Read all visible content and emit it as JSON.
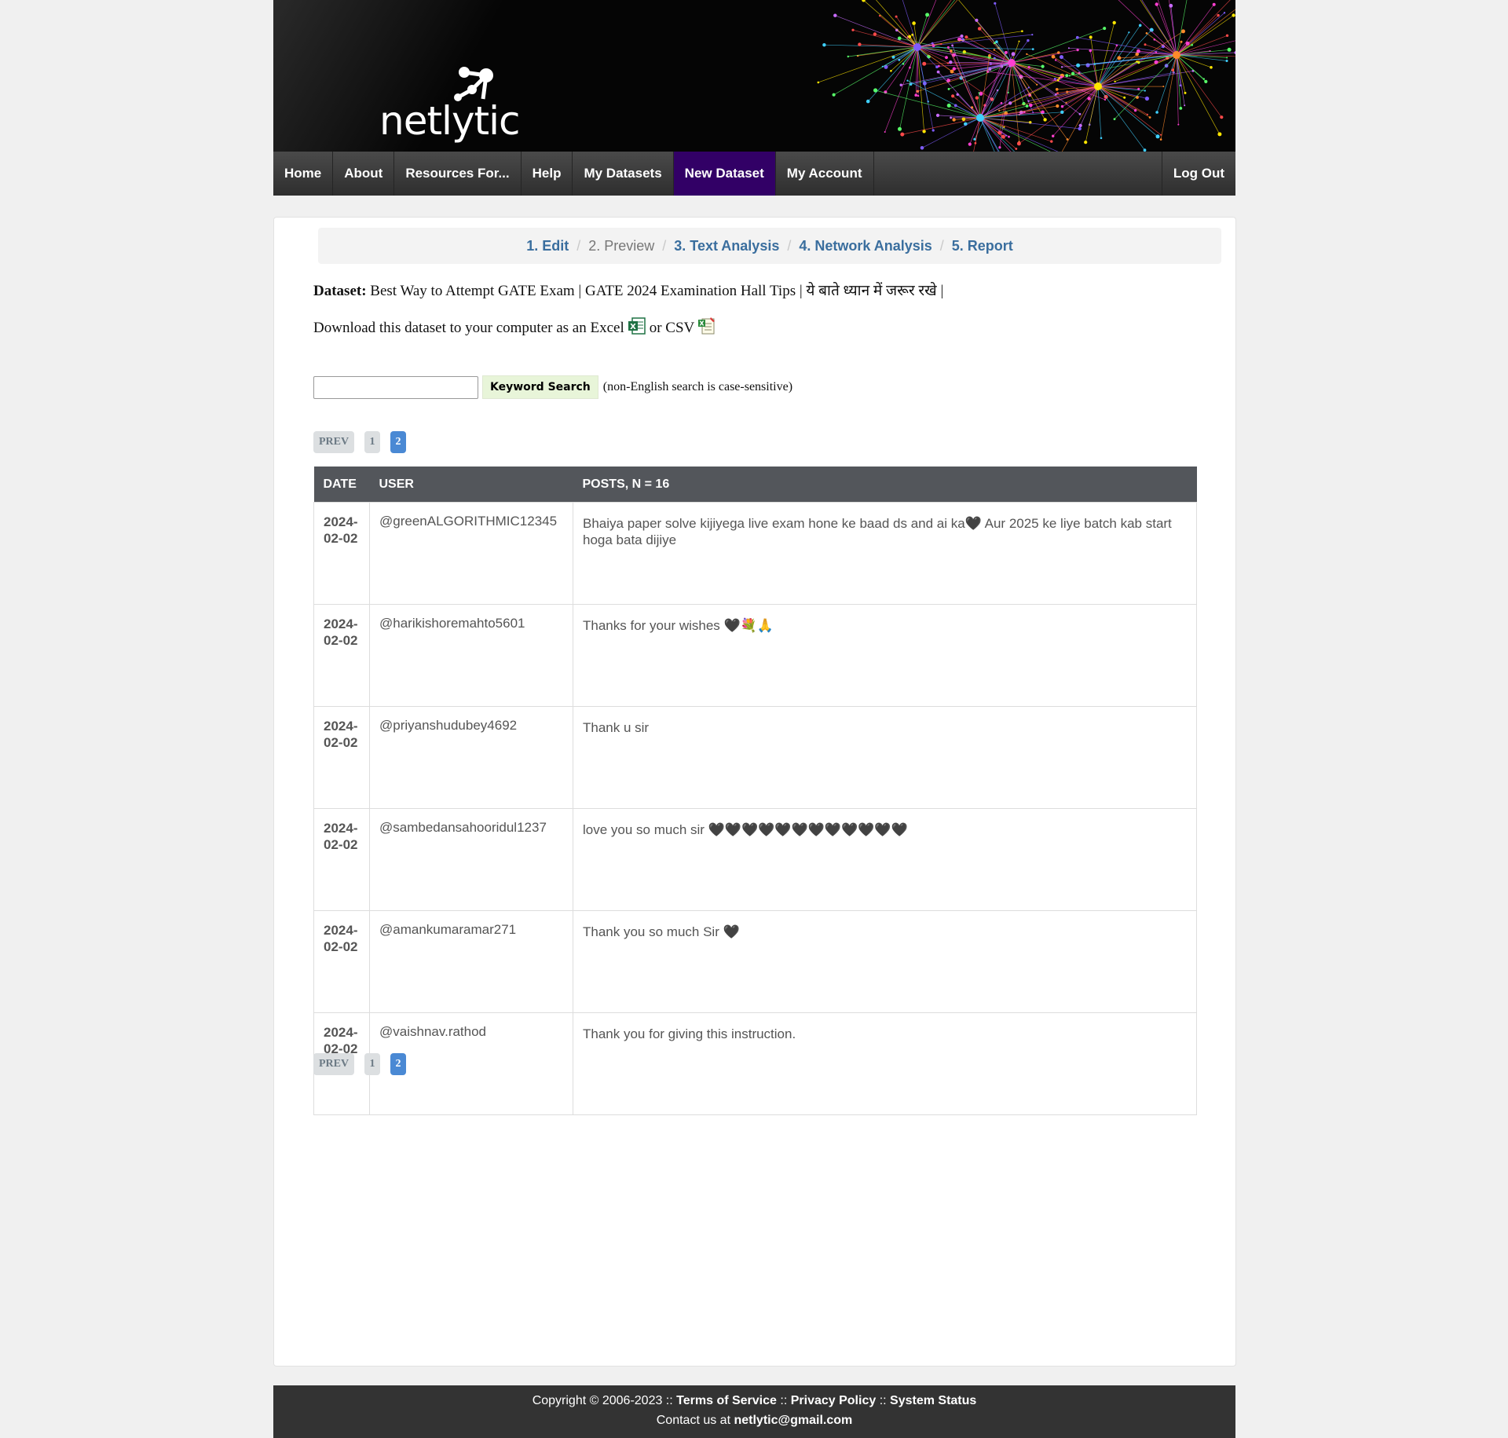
{
  "brand": {
    "logo_text": "netlytic"
  },
  "nav": {
    "items": [
      {
        "label": "Home"
      },
      {
        "label": "About"
      },
      {
        "label": "Resources For..."
      },
      {
        "label": "Help"
      },
      {
        "label": "My Datasets"
      },
      {
        "label": "New Dataset",
        "active": true
      },
      {
        "label": "My Account"
      }
    ],
    "logout": "Log Out"
  },
  "steps": [
    {
      "label": "1. Edit",
      "state": "link"
    },
    {
      "label": "2. Preview",
      "state": "current"
    },
    {
      "label": "3. Text Analysis",
      "state": "link"
    },
    {
      "label": "4. Network Analysis",
      "state": "link"
    },
    {
      "label": "5. Report",
      "state": "link"
    }
  ],
  "dataset": {
    "label": "Dataset:",
    "name": "Best Way to Attempt GATE Exam | GATE 2024 Examination Hall Tips | ये बाते ध्यान में जरूर रखे |"
  },
  "download": {
    "text_before": "Download this dataset to your computer as an Excel",
    "text_mid": "or CSV",
    "excel_icon": "excel-icon",
    "csv_icon": "csv-icon"
  },
  "search": {
    "value": "",
    "placeholder": "",
    "button_label": "Keyword Search",
    "note": "(non-English search is case-sensitive)"
  },
  "pagination": {
    "prev": "PREV",
    "pages": [
      "1",
      "2"
    ],
    "current": "2"
  },
  "table": {
    "headers": {
      "date": "DATE",
      "user": "USER",
      "posts": "POSTS, N = 16"
    },
    "rows": [
      {
        "date": "2024-02-02",
        "user": "@greenALGORITHMIC12345",
        "post": "Bhaiya paper solve kijiyega live exam hone ke baad ds and ai ka🖤 Aur 2025 ke liye batch kab start hoga bata dijiye"
      },
      {
        "date": "2024-02-02",
        "user": "@harikishoremahto5601",
        "post": "Thanks for your wishes 🖤💐🙏"
      },
      {
        "date": "2024-02-02",
        "user": "@priyanshudubey4692",
        "post": "Thank u sir"
      },
      {
        "date": "2024-02-02",
        "user": "@sambedansahooridul1237",
        "post": "love you so much sir 🖤🖤🖤🖤🖤🖤🖤🖤🖤🖤🖤🖤"
      },
      {
        "date": "2024-02-02",
        "user": "@amankumaramar271",
        "post": "Thank you so much Sir 🖤"
      },
      {
        "date": "2024-02-02",
        "user": "@vaishnav.rathod",
        "post": "Thank you for giving this instruction."
      }
    ]
  },
  "footer": {
    "copyright": "Copyright © 2006-2023 ::",
    "terms": "Terms of Service",
    "sep1": "::",
    "privacy": "Privacy Policy",
    "sep2": "::",
    "status": "System Status",
    "contact_label": "Contact us at",
    "email": "netlytic@gmail.com"
  }
}
